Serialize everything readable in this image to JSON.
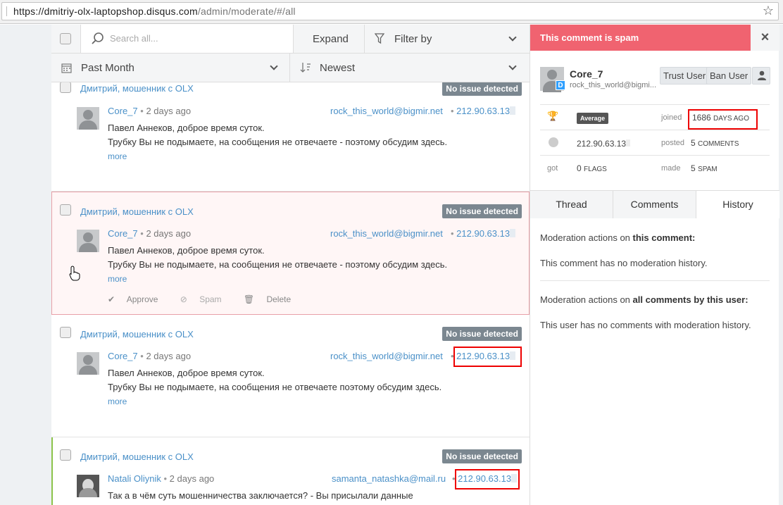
{
  "browser": {
    "url_host": "https://dmitriy-olx-laptopshop.disqus.com",
    "url_path": "/admin/moderate/#/all"
  },
  "toolbar": {
    "search_placeholder": "Search all...",
    "expand_label": "Expand",
    "filter_label": "Filter by",
    "period_label": "Past Month",
    "sort_label": "Newest"
  },
  "comments": [
    {
      "thread": "Дмитрий, мошенник с OLX",
      "status": "No issue detected",
      "author": "Core_7",
      "time": "2 days ago",
      "email": "rock_this_world@bigmir.net",
      "ip": "212.90.63.13",
      "line1": "Павел Аннеков, доброе время суток.",
      "line2": "Трубку Вы не подымаете, на сообщения не отвечаете - поэтому обсудим здесь.",
      "more": "more"
    },
    {
      "thread": "Дмитрий, мошенник с OLX",
      "status": "No issue detected",
      "author": "Core_7",
      "time": "2 days ago",
      "email": "rock_this_world@bigmir.net",
      "ip": "212.90.63.13",
      "line1": "Павел Аннеков, доброе время суток.",
      "line2": "Трубку Вы не подымаете, на сообщения не отвечаете - поэтому обсудим здесь.",
      "more": "more",
      "approve": "Approve",
      "spam": "Spam",
      "delete": "Delete"
    },
    {
      "thread": "Дмитрий, мошенник с OLX",
      "status": "No issue detected",
      "author": "Core_7",
      "time": "2 days ago",
      "email": "rock_this_world@bigmir.net",
      "ip": "212.90.63.13",
      "line1": "Павел Аннеков, доброе время суток.",
      "line2": "Трубку Вы не подымаете, на сообщения не отвечаете поэтому обсудим здесь.",
      "more": "more"
    },
    {
      "thread": "Дмитрий, мошенник с OLX",
      "status": "No issue detected",
      "author": "Natali Oliynik",
      "time": "2 days ago",
      "email": "samanta_natashka@mail.ru",
      "ip": "212.90.63.13",
      "line1": "Так а в чём суть мошенничества заключается? - Вы присылали данные"
    }
  ],
  "panel": {
    "spam_title": "This comment is spam",
    "close_icon": "×",
    "username": "Core_7",
    "email": "rock_this_world@bigmi...",
    "badge_letter": "D",
    "trust_label": "Trust User",
    "ban_label": "Ban User",
    "stats": {
      "reputation": "Average",
      "joined_label": "joined",
      "joined_value": "1686",
      "joined_unit": "DAYS AGO",
      "ip": "212.90.63.13",
      "posted_label": "posted",
      "posted_value": "5",
      "posted_unit": "COMMENTS",
      "got_label": "got",
      "flags_value": "0",
      "flags_unit": "FLAGS",
      "made_label": "made",
      "spam_value": "5",
      "spam_unit": "SPAM"
    },
    "tabs": [
      "Thread",
      "Comments",
      "History"
    ],
    "history": {
      "this_prefix": "Moderation actions on ",
      "this_bold": "this comment:",
      "this_none": "This comment has no moderation history.",
      "all_prefix": "Moderation actions on ",
      "all_bold": "all comments by this user:",
      "all_none": "This user has no comments with moderation history."
    }
  }
}
